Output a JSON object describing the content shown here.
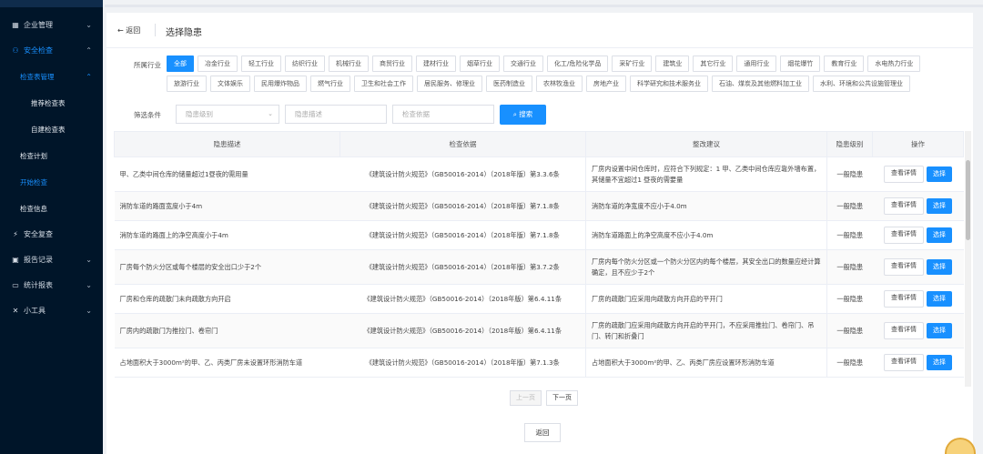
{
  "sidebar": {
    "items": [
      {
        "label": "企业管理",
        "icon": "building-icon"
      },
      {
        "label": "安全检查",
        "icon": "people-icon"
      },
      {
        "label": "检查表管理"
      },
      {
        "label": "推荐检查表"
      },
      {
        "label": "自建检查表"
      },
      {
        "label": "检查计划"
      },
      {
        "label": "开始检查"
      },
      {
        "label": "检查信息"
      },
      {
        "label": "安全复查",
        "icon": "bolt-icon"
      },
      {
        "label": "报告记录",
        "icon": "calendar-icon"
      },
      {
        "label": "统计报表",
        "icon": "folder-icon"
      },
      {
        "label": "小工具",
        "icon": "tools-icon"
      }
    ]
  },
  "header": {
    "back_label": "返回",
    "title": "选择隐患"
  },
  "industry": {
    "label": "所属行业",
    "tags": [
      "全部",
      "冶金行业",
      "轻工行业",
      "纺织行业",
      "机械行业",
      "商贸行业",
      "建材行业",
      "烟草行业",
      "交通行业",
      "化工/危险化学品",
      "采矿行业",
      "建筑业",
      "其它行业",
      "通用行业",
      "烟花爆竹",
      "教育行业",
      "水电热力行业",
      "旅游行业",
      "文体娱乐",
      "民用爆炸物品",
      "燃气行业",
      "卫生和社会工作",
      "居民服务、修理业",
      "医药制造业",
      "农林牧渔业",
      "房地产业",
      "科学研究和技术服务业",
      "石油、煤炭及其他燃料加工业",
      "水利、环境和公共设施管理业"
    ],
    "selected": "全部"
  },
  "filter": {
    "label": "筛选条件",
    "level_placeholder": "隐患级别",
    "desc_placeholder": "隐患描述",
    "basis_placeholder": "检查依据",
    "search_label": "搜索"
  },
  "table": {
    "headers": [
      "隐患描述",
      "检查依据",
      "整改建议",
      "隐患级别",
      "操作"
    ],
    "rows": [
      {
        "desc": "甲、乙类中间仓库的储量超过1昼夜的需用量",
        "basis": "《建筑设计防火规范》（GB50016-2014）（2018年版）第3.3.6条",
        "advice": "厂房内设置中间仓库时，应符合下列规定：1 甲、乙类中间仓库应靠外墙布置，其储量不宜超过1 昼夜的需要量",
        "level": "一般隐患"
      },
      {
        "desc": "消防车道的路面宽度小于4m",
        "basis": "《建筑设计防火规范》（GB50016-2014）（2018年版）第7.1.8条",
        "advice": "消防车道的净宽度不应小于4.0m",
        "level": "一般隐患"
      },
      {
        "desc": "消防车道的路面上的净空高度小于4m",
        "basis": "《建筑设计防火规范》（GB50016-2014）（2018年版）第7.1.8条",
        "advice": "消防车道路面上的净空高度不应小于4.0m",
        "level": "一般隐患"
      },
      {
        "desc": "厂房每个防火分区或每个楼层的安全出口少于2个",
        "basis": "《建筑设计防火规范》（GB50016-2014）（2018年版）第3.7.2条",
        "advice": "厂房内每个防火分区或一个防火分区内的每个楼层，其安全出口的数量应经计算确定，且不应少于2个",
        "level": "一般隐患"
      },
      {
        "desc": "厂房和仓库的疏散门未向疏散方向开启",
        "basis": "《建筑设计防火规范》（GB50016-2014）（2018年版）第6.4.11条",
        "advice": "厂房的疏散门应采用向疏散方向开启的平开门",
        "level": "一般隐患"
      },
      {
        "desc": "厂房内的疏散门为推拉门、卷帘门",
        "basis": "《建筑设计防火规范》（GB50016-2014）（2018年版）第6.4.11条",
        "advice": "厂房的疏散门应采用向疏散方向开启的平开门，不应采用推拉门、卷帘门、吊门、转门和折叠门",
        "level": "一般隐患"
      },
      {
        "desc": "占地面积大于3000m²的甲、乙、丙类厂房未设置环形消防车道",
        "basis": "《建筑设计防火规范》（GB50016-2014）（2018年版）第7.1.3条",
        "advice": "占地面积大于3000m²的甲、乙、丙类厂房应设置环形消防车道",
        "level": "一般隐患"
      }
    ],
    "detail_label": "查看详情",
    "choose_label": "选择"
  },
  "pagination": {
    "prev_label": "上一页",
    "next_label": "下一页"
  },
  "footer": {
    "return_label": "返回"
  }
}
